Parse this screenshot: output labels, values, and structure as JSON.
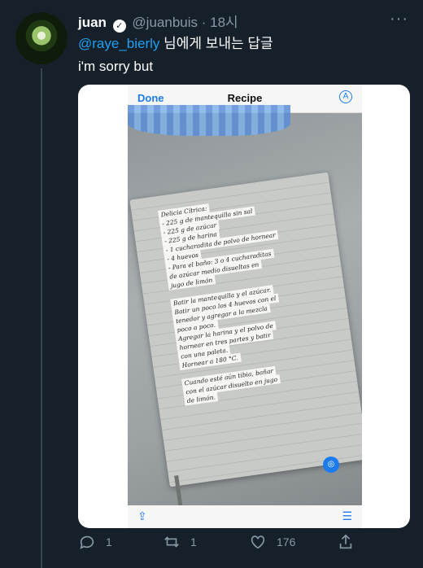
{
  "tweet": {
    "name": "juan",
    "handle": "@juanbuis",
    "time": "· 18시",
    "reply_mention": "@raye_bierly",
    "reply_suffix": " 님에게 보내는 답글",
    "text": "i'm sorry but",
    "more_label": "···"
  },
  "media": {
    "done_label": "Done",
    "title": "Recipe",
    "note_lines": [
      "Delicia Cítrica:",
      "- 225 g de mantequilla sin sal",
      "- 225 g de azúcar",
      "- 225 g de harina",
      "- 1 cucharadita de polvo de hornear",
      "- 4 huevos",
      "- Para el baño: 3 o 4 cucharaditas",
      "de azúcar medio disueltas en",
      "jugo de limón",
      "",
      "Batir la mantequilla y el azúcar.",
      "Batir un poco los 4 huevos con el",
      "tenedor y agregar a la mezcla",
      "poco a poco.",
      "Agregar la harina y el polvo de",
      "hornear en tres partes y batir",
      "con una paleta.",
      "Hornear a 180 °C.",
      "",
      "Cuando esté aún tibia, bañar",
      "con el azúcar disuelto en jugo",
      "de limón."
    ]
  },
  "actions": {
    "replies": "1",
    "retweets": "1",
    "likes": "176"
  },
  "colors": {
    "background": "#15202b",
    "accent": "#1da1f2",
    "muted": "#8899a6"
  }
}
